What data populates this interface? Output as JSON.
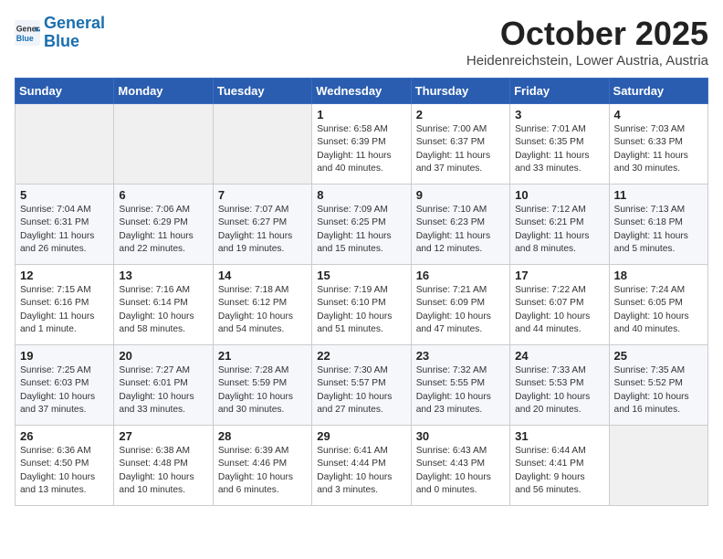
{
  "header": {
    "logo_line1": "General",
    "logo_line2": "Blue",
    "month": "October 2025",
    "location": "Heidenreichstein, Lower Austria, Austria"
  },
  "weekdays": [
    "Sunday",
    "Monday",
    "Tuesday",
    "Wednesday",
    "Thursday",
    "Friday",
    "Saturday"
  ],
  "weeks": [
    [
      {
        "day": "",
        "info": ""
      },
      {
        "day": "",
        "info": ""
      },
      {
        "day": "",
        "info": ""
      },
      {
        "day": "1",
        "info": "Sunrise: 6:58 AM\nSunset: 6:39 PM\nDaylight: 11 hours\nand 40 minutes."
      },
      {
        "day": "2",
        "info": "Sunrise: 7:00 AM\nSunset: 6:37 PM\nDaylight: 11 hours\nand 37 minutes."
      },
      {
        "day": "3",
        "info": "Sunrise: 7:01 AM\nSunset: 6:35 PM\nDaylight: 11 hours\nand 33 minutes."
      },
      {
        "day": "4",
        "info": "Sunrise: 7:03 AM\nSunset: 6:33 PM\nDaylight: 11 hours\nand 30 minutes."
      }
    ],
    [
      {
        "day": "5",
        "info": "Sunrise: 7:04 AM\nSunset: 6:31 PM\nDaylight: 11 hours\nand 26 minutes."
      },
      {
        "day": "6",
        "info": "Sunrise: 7:06 AM\nSunset: 6:29 PM\nDaylight: 11 hours\nand 22 minutes."
      },
      {
        "day": "7",
        "info": "Sunrise: 7:07 AM\nSunset: 6:27 PM\nDaylight: 11 hours\nand 19 minutes."
      },
      {
        "day": "8",
        "info": "Sunrise: 7:09 AM\nSunset: 6:25 PM\nDaylight: 11 hours\nand 15 minutes."
      },
      {
        "day": "9",
        "info": "Sunrise: 7:10 AM\nSunset: 6:23 PM\nDaylight: 11 hours\nand 12 minutes."
      },
      {
        "day": "10",
        "info": "Sunrise: 7:12 AM\nSunset: 6:21 PM\nDaylight: 11 hours\nand 8 minutes."
      },
      {
        "day": "11",
        "info": "Sunrise: 7:13 AM\nSunset: 6:18 PM\nDaylight: 11 hours\nand 5 minutes."
      }
    ],
    [
      {
        "day": "12",
        "info": "Sunrise: 7:15 AM\nSunset: 6:16 PM\nDaylight: 11 hours\nand 1 minute."
      },
      {
        "day": "13",
        "info": "Sunrise: 7:16 AM\nSunset: 6:14 PM\nDaylight: 10 hours\nand 58 minutes."
      },
      {
        "day": "14",
        "info": "Sunrise: 7:18 AM\nSunset: 6:12 PM\nDaylight: 10 hours\nand 54 minutes."
      },
      {
        "day": "15",
        "info": "Sunrise: 7:19 AM\nSunset: 6:10 PM\nDaylight: 10 hours\nand 51 minutes."
      },
      {
        "day": "16",
        "info": "Sunrise: 7:21 AM\nSunset: 6:09 PM\nDaylight: 10 hours\nand 47 minutes."
      },
      {
        "day": "17",
        "info": "Sunrise: 7:22 AM\nSunset: 6:07 PM\nDaylight: 10 hours\nand 44 minutes."
      },
      {
        "day": "18",
        "info": "Sunrise: 7:24 AM\nSunset: 6:05 PM\nDaylight: 10 hours\nand 40 minutes."
      }
    ],
    [
      {
        "day": "19",
        "info": "Sunrise: 7:25 AM\nSunset: 6:03 PM\nDaylight: 10 hours\nand 37 minutes."
      },
      {
        "day": "20",
        "info": "Sunrise: 7:27 AM\nSunset: 6:01 PM\nDaylight: 10 hours\nand 33 minutes."
      },
      {
        "day": "21",
        "info": "Sunrise: 7:28 AM\nSunset: 5:59 PM\nDaylight: 10 hours\nand 30 minutes."
      },
      {
        "day": "22",
        "info": "Sunrise: 7:30 AM\nSunset: 5:57 PM\nDaylight: 10 hours\nand 27 minutes."
      },
      {
        "day": "23",
        "info": "Sunrise: 7:32 AM\nSunset: 5:55 PM\nDaylight: 10 hours\nand 23 minutes."
      },
      {
        "day": "24",
        "info": "Sunrise: 7:33 AM\nSunset: 5:53 PM\nDaylight: 10 hours\nand 20 minutes."
      },
      {
        "day": "25",
        "info": "Sunrise: 7:35 AM\nSunset: 5:52 PM\nDaylight: 10 hours\nand 16 minutes."
      }
    ],
    [
      {
        "day": "26",
        "info": "Sunrise: 6:36 AM\nSunset: 4:50 PM\nDaylight: 10 hours\nand 13 minutes."
      },
      {
        "day": "27",
        "info": "Sunrise: 6:38 AM\nSunset: 4:48 PM\nDaylight: 10 hours\nand 10 minutes."
      },
      {
        "day": "28",
        "info": "Sunrise: 6:39 AM\nSunset: 4:46 PM\nDaylight: 10 hours\nand 6 minutes."
      },
      {
        "day": "29",
        "info": "Sunrise: 6:41 AM\nSunset: 4:44 PM\nDaylight: 10 hours\nand 3 minutes."
      },
      {
        "day": "30",
        "info": "Sunrise: 6:43 AM\nSunset: 4:43 PM\nDaylight: 10 hours\nand 0 minutes."
      },
      {
        "day": "31",
        "info": "Sunrise: 6:44 AM\nSunset: 4:41 PM\nDaylight: 9 hours\nand 56 minutes."
      },
      {
        "day": "",
        "info": ""
      }
    ]
  ]
}
